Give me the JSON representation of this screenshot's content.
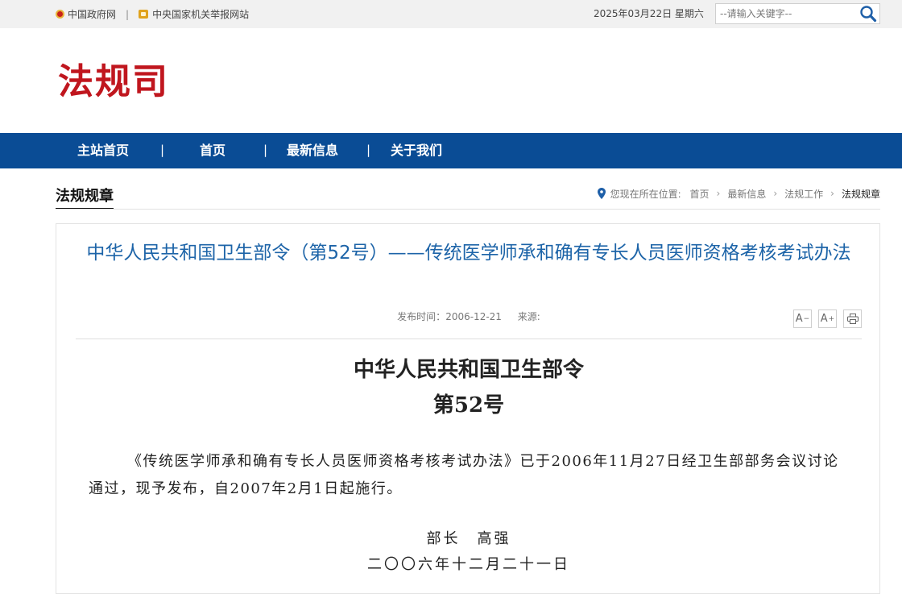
{
  "topbar": {
    "links": [
      {
        "label": "中国政府网",
        "icon": "national-emblem-icon"
      },
      {
        "label": "中央国家机关举报网站",
        "icon": "report-icon"
      }
    ],
    "separator": "|",
    "date": "2025年03月22日 星期六",
    "search_placeholder": "--请输入关键字--"
  },
  "header": {
    "logo_text": "法规司",
    "logo_color": "#c0161e"
  },
  "nav": {
    "background": "#0a4c95",
    "items": [
      "主站首页",
      "首页",
      "最新信息",
      "关于我们"
    ],
    "divider": "|"
  },
  "section": {
    "title": "法规规章"
  },
  "breadcrumb": {
    "prefix": "您现在所在位置:",
    "items": [
      "首页",
      "最新信息",
      "法规工作",
      "法规规章"
    ]
  },
  "article": {
    "title": "中华人民共和国卫生部令（第52号）——传统医学师承和确有专长人员医师资格考核考试办法",
    "publish_label": "发布时间：",
    "publish_date": "2006-12-21",
    "source_label": "来源:",
    "tools": {
      "font_smaller": "A",
      "font_larger": "A",
      "print_icon": "print-icon"
    },
    "doc_heading_line1": "中华人民共和国卫生部令",
    "doc_heading_line2": "第52号",
    "body": "《传统医学师承和确有专长人员医师资格考核考试办法》已于2006年11月27日经卫生部部务会议讨论通过，现予发布，自2007年2月1日起施行。",
    "signature": "部长　高强",
    "sign_date": "二〇〇六年十二月二十一日"
  }
}
